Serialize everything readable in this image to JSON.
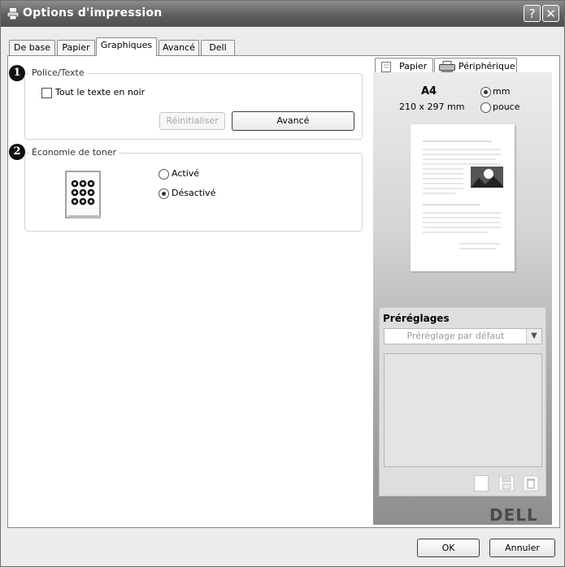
{
  "window": {
    "title": "Options d'impression",
    "help_label": "?",
    "close_label": "✕"
  },
  "tabs": [
    {
      "label": "De base"
    },
    {
      "label": "Papier"
    },
    {
      "label": "Graphiques"
    },
    {
      "label": "Avancé"
    },
    {
      "label": "Dell"
    }
  ],
  "active_tab": "Graphiques",
  "font_text": {
    "badge": "1",
    "title": "Police/Texte",
    "all_black_label": "Tout le texte en noir",
    "all_black_checked": false,
    "reset_label": "Réinitialiser",
    "advanced_label": "Avancé"
  },
  "toner": {
    "badge": "2",
    "title": "Économie de toner",
    "on_label": "Activé",
    "off_label": "Désactivé",
    "selected": "Désactivé"
  },
  "preview": {
    "tabs": [
      {
        "label": "Papier"
      },
      {
        "label": "Périphérique"
      }
    ],
    "paper_name": "A4",
    "paper_size": "210 x 297 mm",
    "unit_mm": "mm",
    "unit_inch": "pouce",
    "unit_selected": "mm"
  },
  "presets": {
    "title": "Préréglages",
    "selected": "Préréglage par défaut"
  },
  "brand": {
    "logo": "DELL"
  },
  "footer": {
    "ok_label": "OK",
    "cancel_label": "Annuler"
  }
}
